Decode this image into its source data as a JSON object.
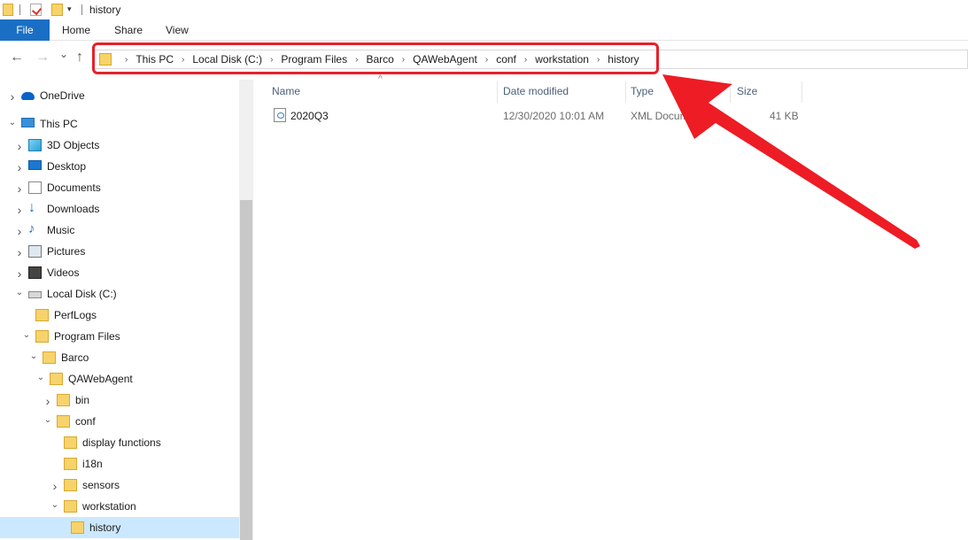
{
  "window": {
    "title": "history"
  },
  "ribbon": {
    "tabs": [
      "File",
      "Home",
      "Share",
      "View"
    ]
  },
  "nav": {
    "back_glyph": "←",
    "forward_glyph": "→",
    "recent_glyph": "⌄",
    "up_glyph": "↑"
  },
  "address": {
    "crumbs": [
      "This PC",
      "Local Disk (C:)",
      "Program Files",
      "Barco",
      "QAWebAgent",
      "conf",
      "workstation",
      "history"
    ]
  },
  "sidebar": {
    "items": [
      {
        "label": "OneDrive",
        "icon": "onedrive-icon",
        "expand": "collapsed"
      },
      {
        "label": "This PC",
        "icon": "this-pc-icon",
        "expand": "expanded"
      },
      {
        "label": "3D Objects",
        "icon": "3d-objects-icon",
        "expand": "collapsed"
      },
      {
        "label": "Desktop",
        "icon": "desktop-icon",
        "expand": "collapsed"
      },
      {
        "label": "Documents",
        "icon": "documents-icon",
        "expand": "collapsed"
      },
      {
        "label": "Downloads",
        "icon": "downloads-icon",
        "expand": "collapsed"
      },
      {
        "label": "Music",
        "icon": "music-icon",
        "expand": "collapsed"
      },
      {
        "label": "Pictures",
        "icon": "pictures-icon",
        "expand": "collapsed"
      },
      {
        "label": "Videos",
        "icon": "videos-icon",
        "expand": "collapsed"
      },
      {
        "label": "Local Disk (C:)",
        "icon": "local-disk-icon",
        "expand": "expanded"
      },
      {
        "label": "PerfLogs",
        "icon": "folder-icon",
        "expand": "none"
      },
      {
        "label": "Program Files",
        "icon": "folder-icon",
        "expand": "expanded"
      },
      {
        "label": "Barco",
        "icon": "folder-icon",
        "expand": "expanded"
      },
      {
        "label": "QAWebAgent",
        "icon": "folder-icon",
        "expand": "expanded"
      },
      {
        "label": "bin",
        "icon": "folder-icon",
        "expand": "collapsed"
      },
      {
        "label": "conf",
        "icon": "folder-icon",
        "expand": "expanded"
      },
      {
        "label": "display functions",
        "icon": "folder-icon",
        "expand": "none"
      },
      {
        "label": "i18n",
        "icon": "folder-icon",
        "expand": "none"
      },
      {
        "label": "sensors",
        "icon": "folder-icon",
        "expand": "collapsed"
      },
      {
        "label": "workstation",
        "icon": "folder-icon",
        "expand": "expanded"
      },
      {
        "label": "history",
        "icon": "folder-icon",
        "expand": "none",
        "selected": true
      }
    ]
  },
  "columns": {
    "name": "Name",
    "date": "Date modified",
    "type": "Type",
    "size": "Size"
  },
  "files": [
    {
      "name": "2020Q3",
      "date": "12/30/2020 10:01 AM",
      "type": "XML Document",
      "size": "41 KB"
    }
  ],
  "colors": {
    "accent": "#1a6fc4",
    "highlight": "#e8202a",
    "selected": "#cce8ff"
  }
}
